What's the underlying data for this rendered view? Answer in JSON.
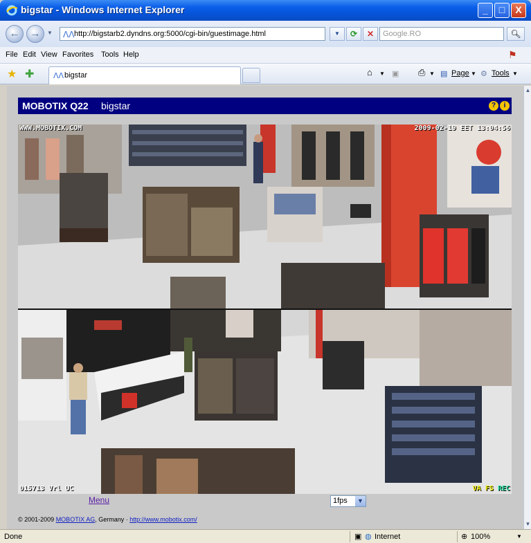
{
  "window": {
    "title": "bigstar - Windows Internet Explorer",
    "controls": {
      "minimize": "_",
      "maximize": "□",
      "close": "X"
    }
  },
  "addressbar": {
    "url": "http://bigstarb2.dyndns.org:5000/cgi-bin/guestimage.html",
    "search_placeholder": "Google.RO"
  },
  "menubar": {
    "items": [
      "File",
      "Edit",
      "View",
      "Favorites",
      "Tools",
      "Help"
    ]
  },
  "toolbar": {
    "tab_label": "bigstar",
    "page_label": "Page",
    "tools_label": "Tools"
  },
  "camera": {
    "brand": "MOBOTIX Q22",
    "name": "bigstar",
    "osd_site": "WWW.MOBOTIX.COM",
    "osd_timestamp": "2009-02-19 EET 13:04:56",
    "osd_frame": "015713 Vrl UC",
    "osd_flags": [
      "VA",
      "FS",
      "REC"
    ],
    "menu_link": "Menu",
    "fps_value": "1fps"
  },
  "footer": {
    "copyright": "© 2001-2009",
    "company_link": "MOBOTIX AG",
    "country": ", Germany ·",
    "site_link": "http://www.mobotix.com/"
  },
  "statusbar": {
    "status": "Done",
    "zone": "Internet",
    "zoom": "100%"
  },
  "colors": {
    "header_bg": "#000080",
    "title_bar": "#0a5ee8",
    "link": "#1020c0",
    "visited_link": "#5a1ea6"
  }
}
